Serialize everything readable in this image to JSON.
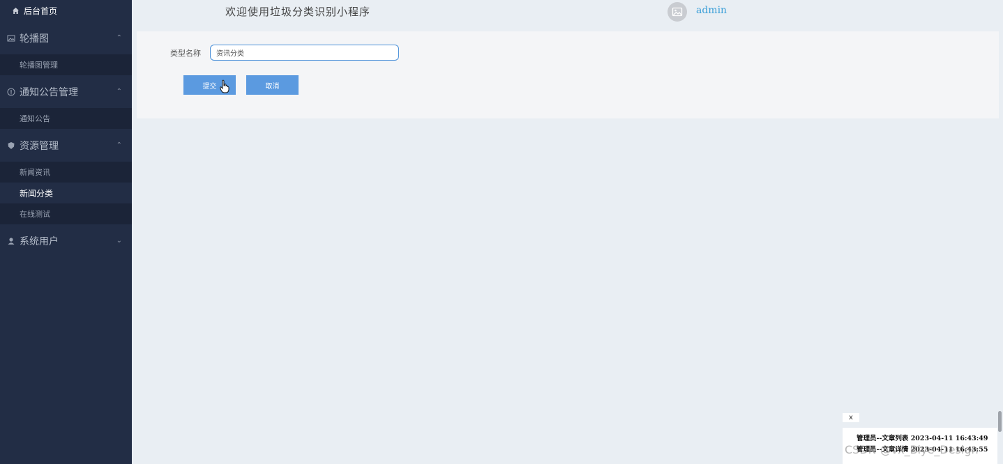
{
  "sidebar": {
    "home_label": "后台首页",
    "groups": [
      {
        "label": "轮播图",
        "icon": "image-icon",
        "chevron": "⌃",
        "items": [
          {
            "label": "轮播图管理",
            "active": false
          }
        ]
      },
      {
        "label": "通知公告管理",
        "icon": "info-icon",
        "chevron": "⌃",
        "items": [
          {
            "label": "通知公告",
            "active": false
          }
        ]
      },
      {
        "label": "资源管理",
        "icon": "shield-icon",
        "chevron": "⌃",
        "items": [
          {
            "label": "新闻资讯",
            "active": false
          },
          {
            "label": "新闻分类",
            "active": true
          },
          {
            "label": "在线测试",
            "active": false
          }
        ]
      },
      {
        "label": "系统用户",
        "icon": "user-icon",
        "chevron": "⌄",
        "items": []
      }
    ]
  },
  "header": {
    "title": "欢迎使用垃圾分类识别小程序",
    "username": "admin"
  },
  "form": {
    "field_label": "类型名称",
    "field_value": "资讯分类",
    "submit_label": "提交",
    "cancel_label": "取消"
  },
  "notice": {
    "close_label": "x",
    "lines": [
      "管理员--文章列表 2023-04-11 16:43:49",
      "管理员--文章详情 2023-04-11 16:43:55"
    ]
  },
  "watermark": "CSDN @vx_Biye_Design",
  "colors": {
    "sidebar_bg": "#222d45",
    "accent": "#5b9ae0",
    "username": "#3b9fd8"
  }
}
